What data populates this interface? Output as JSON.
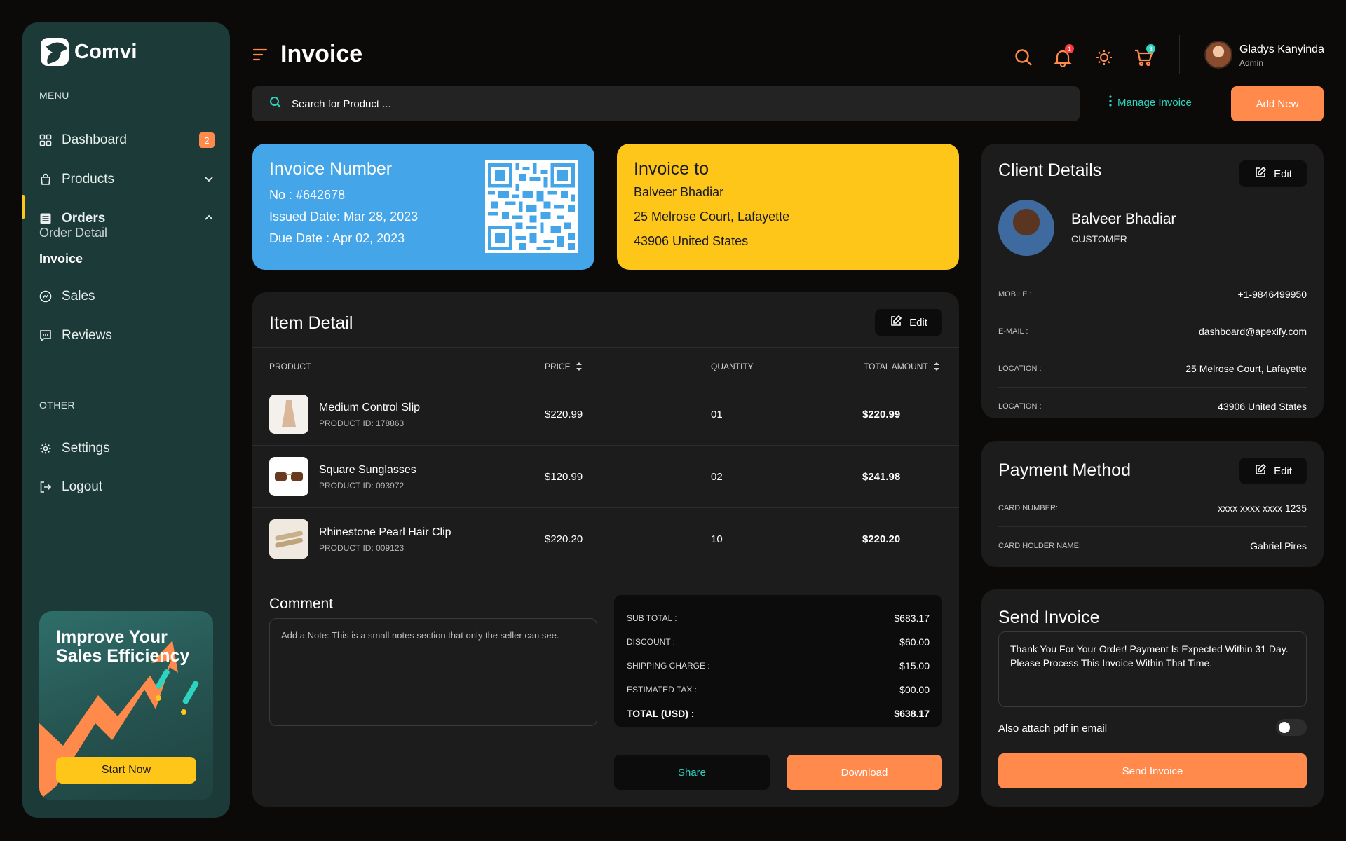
{
  "brand": {
    "name": "Comvi"
  },
  "sidebar": {
    "menu_label": "MENU",
    "other_label": "OTHER",
    "items": [
      {
        "label": "Dashboard",
        "icon": "grid-icon",
        "badge": "2"
      },
      {
        "label": "Products",
        "icon": "bag-icon"
      },
      {
        "label": "Orders",
        "icon": "list-icon"
      },
      {
        "label": "Sales",
        "icon": "chart-icon"
      },
      {
        "label": "Reviews",
        "icon": "review-icon"
      }
    ],
    "orders_sub": [
      "Order Detail",
      "Invoice"
    ],
    "other_items": [
      {
        "label": "Settings",
        "icon": "gear-icon"
      },
      {
        "label": "Logout",
        "icon": "logout-icon"
      }
    ],
    "promo": {
      "title": "Improve Your Sales Efficiency",
      "button": "Start Now"
    }
  },
  "header": {
    "title": "Invoice",
    "notification_count": "1",
    "cart_count": "3",
    "user": {
      "name": "Gladys Kanyinda",
      "role": "Admin"
    }
  },
  "search": {
    "placeholder": "Search for Product ..."
  },
  "actions": {
    "manage": "Manage Invoice",
    "add_new": "Add New"
  },
  "invoice_number_card": {
    "title": "Invoice Number",
    "no": "No : #642678",
    "issued": "Issued Date: Mar 28, 2023",
    "due": "Due Date : Apr 02, 2023"
  },
  "invoice_to_card": {
    "title": "Invoice to",
    "name": "Balveer Bhadiar",
    "address1": "25 Melrose Court, Lafayette",
    "address2": "43906  United States"
  },
  "item_detail": {
    "title": "Item Detail",
    "edit": "Edit",
    "columns": [
      "PRODUCT",
      "PRICE",
      "QUANTITY",
      "TOTAL AMOUNT"
    ],
    "rows": [
      {
        "name": "Medium Control Slip",
        "pid": "PRODUCT ID: 178863",
        "price": "$220.99",
        "qty": "01",
        "total": "$220.99"
      },
      {
        "name": "Square Sunglasses",
        "pid": "PRODUCT ID: 093972",
        "price": "$120.99",
        "qty": "02",
        "total": "$241.98"
      },
      {
        "name": "Rhinestone Pearl Hair Clip",
        "pid": "PRODUCT ID: 009123",
        "price": "$220.20",
        "qty": "10",
        "total": "$220.20"
      }
    ],
    "comment_title": "Comment",
    "comment_text": "Add a Note:  This is a small notes section that only the seller can see.",
    "summary": [
      {
        "label": "SUB TOTAL :",
        "value": "$683.17"
      },
      {
        "label": "DISCOUNT :",
        "value": "$60.00"
      },
      {
        "label": "SHIPPING CHARGE :",
        "value": "$15.00"
      },
      {
        "label": "ESTIMATED TAX :",
        "value": "$00.00"
      }
    ],
    "total_label": "TOTAL (USD) :",
    "total_value": "$638.17",
    "share": "Share",
    "download": "Download"
  },
  "client": {
    "title": "Client Details",
    "edit": "Edit",
    "name": "Balveer Bhadiar",
    "role": "CUSTOMER",
    "fields": [
      {
        "label": "MOBILE :",
        "value": "+1-9846499950"
      },
      {
        "label": "E-MAIL :",
        "value": "dashboard@apexify.com"
      },
      {
        "label": "LOCATION :",
        "value": "25 Melrose Court, Lafayette"
      },
      {
        "label": "LOCATION :",
        "value": "43906  United States"
      }
    ]
  },
  "payment": {
    "title": "Payment Method",
    "edit": "Edit",
    "fields": [
      {
        "label": "CARD NUMBER:",
        "value": "xxxx xxxx xxxx 1235"
      },
      {
        "label": "CARD HOLDER NAME:",
        "value": "Gabriel Pires"
      }
    ]
  },
  "send_invoice": {
    "title": "Send Invoice",
    "message": "Thank You For Your Order! Payment Is Expected Within 31 Day. Please Process This Invoice Within That Time.",
    "attach_label": "Also attach pdf in email",
    "attach_enabled": false,
    "button": "Send Invoice"
  },
  "colors": {
    "accent": "#ff8a4c",
    "teal": "#2ed3c0",
    "yellow": "#ffc61a",
    "blue": "#44a6e9",
    "sidebar": "#1c3a38"
  }
}
